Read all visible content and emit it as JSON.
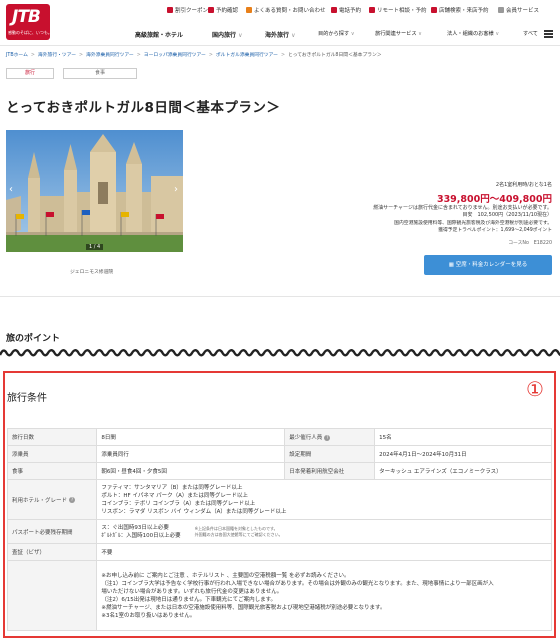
{
  "header": {
    "logo_text": "JTB",
    "logo_tagline": "感動のそばに、いつも。",
    "utility_links": [
      "割引クーポン",
      "予約確認",
      "よくある質問・お問い合わせ",
      "電話予約",
      "リモート相談・予約",
      "店舗検索・来店予約",
      "会員サービス"
    ],
    "nav_items": [
      "高級旅館・ホテル",
      "国内旅行",
      "海外旅行",
      "目的から探す",
      "旅行関連サービス",
      "法人・組織のお客様",
      "すべて"
    ]
  },
  "breadcrumb": [
    "JTBホーム",
    "海外旅行・ツアー",
    "海外添乗員同行ツアー",
    "ヨーロッパ添乗員同行ツアー",
    "ポルトガル添乗員同行ツアー",
    "とっておきポルトガル8日間＜基本プラン＞"
  ],
  "tabs": {
    "active": "旅行",
    "other": "食事"
  },
  "title": "とっておきポルトガル8日間＜基本プラン＞",
  "photo": {
    "counter": "1 / 4",
    "caption": "ジェロニモス修道院"
  },
  "price": {
    "per_person": "2名1室利用時/おとな1名",
    "range": "339,800円～409,800円",
    "unit": "円",
    "surcharge_note": "燃油サーチャージは旅行代金に含まれておりません。別途お支払いが必要です。",
    "target": "目安　102,500円（2023/11/10現在）",
    "tax_line1": "国内空港施設使用料等、国際観光旅客税及び海外空港税が別途必要です。",
    "tax_line2": "獲得予定トラベルポイント：1,699～2,049ポイント",
    "course_no": "コースNo　E18220"
  },
  "calendar_button": "空席・料金カレンダーを見る",
  "points_heading": "旅のポイント",
  "conditions": {
    "heading": "旅行条件",
    "badge": "①",
    "rows": [
      {
        "k1": "旅行日数",
        "v1": "8日間",
        "k2": "最少催行人員",
        "v2": "15名"
      },
      {
        "k1": "添乗員",
        "v1": "添乗員同行",
        "k2": "設定期間",
        "v2": "2024年4月1日～2024年10月31日"
      },
      {
        "k1": "食事",
        "v1": "朝6回・昼食4回・夕食5回",
        "k2": "日本発着利用航空会社",
        "v2": "ターキッシュ エアラインズ（エコノミークラス）"
      }
    ],
    "hotel_label": "利用ホテル・グレード",
    "hotels": [
      "ファティマ：サンタマリア（B）または同等グレード以上",
      "ポルト：HF イパネマ パーク（A）または同等グレード以上",
      "コインブラ：テボリ コインブラ（A）または同等グレード以上",
      "リスボン：ラマダ リスボン バイ ウィンダム（A）または同等グレード以上"
    ],
    "passport_label": "パスポート必要残存期間",
    "passport": [
      "ス：ぐ出国時93日以上必要",
      "ﾎﾟﾙﾄｶﾞﾙ：入国時100日以上必要"
    ],
    "passport_note": "※上記条件は日本国籍を対象としたものです。",
    "passport_note2": "外国籍の方は各国大使館等にてご確認ください。",
    "visa_label": "査証（ビザ）",
    "visa": "不要",
    "notes": [
      "※お申し込み前に ご案内とご注意  、ホテルリスト  、主要国の空港税額一覧  を必ずお読みください。",
      "（注1）コインブラ大学は予告なく学校行事が行われ入場できない場合があります。その場合は外観のみの観光となります。また、現地事情により一部区画が入",
      "場いただけない場合があります。いずれも旅行代金の変更はありません。",
      "（注2）6/15出発は現地日は通りません。下車観光にてご案内します。",
      "※燃油サーチャージ、または日本の空港施設使用料等、国際観光旅客税および現地空港諸税が別途必要となります。",
      "※3名1室のお取り扱いはありません。"
    ]
  }
}
